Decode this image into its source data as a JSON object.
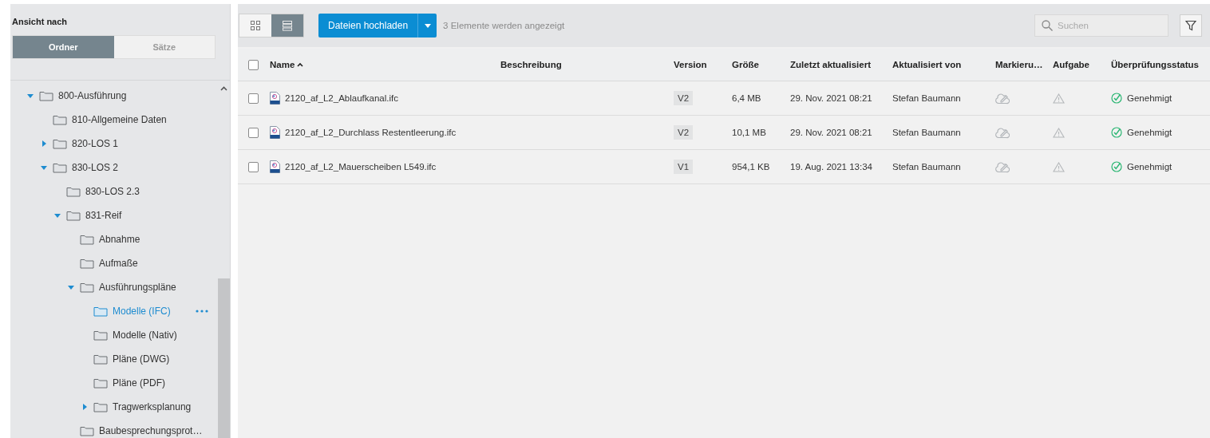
{
  "sidebar": {
    "title": "Ansicht nach",
    "view_tabs": [
      {
        "label": "Ordner",
        "selected": true
      },
      {
        "label": "Sätze",
        "selected": false
      }
    ],
    "tree": [
      {
        "label": "800-Ausführung",
        "expanded": true,
        "selected": false,
        "children": [
          {
            "label": "810-Allgemeine Daten",
            "selected": false
          },
          {
            "label": "820-LOS 1",
            "expanded": false,
            "selected": false
          },
          {
            "label": "830-LOS 2",
            "expanded": true,
            "selected": false,
            "children": [
              {
                "label": "830-LOS 2.3",
                "selected": false
              },
              {
                "label": "831-Reif",
                "expanded": true,
                "selected": false,
                "children": [
                  {
                    "label": "Abnahme",
                    "selected": false
                  },
                  {
                    "label": "Aufmaße",
                    "selected": false
                  },
                  {
                    "label": "Ausführungspläne",
                    "expanded": true,
                    "selected": false,
                    "children": [
                      {
                        "label": "Modelle (IFC)",
                        "selected": true
                      },
                      {
                        "label": "Modelle (Nativ)",
                        "selected": false
                      },
                      {
                        "label": "Pläne (DWG)",
                        "selected": false
                      },
                      {
                        "label": "Pläne (PDF)",
                        "selected": false
                      },
                      {
                        "label": "Tragwerksplanung",
                        "expanded": false,
                        "selected": false
                      }
                    ]
                  },
                  {
                    "label": "Baubesprechungsprot…",
                    "selected": false
                  }
                ]
              }
            ]
          }
        ]
      }
    ]
  },
  "toolbar": {
    "view_modes": [
      {
        "kind": "grid",
        "selected": false
      },
      {
        "kind": "list",
        "selected": true
      }
    ],
    "upload_button": "Dateien hochladen",
    "item_count": "3 Elemente werden angezeigt",
    "search": {
      "placeholder": "Suchen"
    }
  },
  "table": {
    "columns": [
      {
        "label": "Name",
        "sorted": true
      },
      {
        "label": "Beschreibung",
        "sorted": false
      },
      {
        "label": "Version",
        "sorted": false
      },
      {
        "label": "Größe",
        "sorted": false
      },
      {
        "label": "Zuletzt aktualisiert",
        "sorted": false
      },
      {
        "label": "Aktualisiert von",
        "sorted": false
      },
      {
        "label": "Markieru…",
        "sorted": false
      },
      {
        "label": "Aufgabe",
        "sorted": false
      },
      {
        "label": "Überprüfungsstatus",
        "sorted": false
      }
    ],
    "all_checked": false,
    "rows": [
      {
        "checked": false,
        "name": "2120_af_L2_Ablaufkanal.ifc",
        "version": "V2",
        "size": "6,4 MB",
        "updated": "29. Nov. 2021 08:21",
        "updated_by": "Stefan Baumann",
        "status": "Genehmigt"
      },
      {
        "checked": false,
        "name": "2120_af_L2_Durchlass Restentleerung.ifc",
        "version": "V2",
        "size": "10,1 MB",
        "updated": "29. Nov. 2021 08:21",
        "updated_by": "Stefan Baumann",
        "status": "Genehmigt"
      },
      {
        "checked": false,
        "name": "2120_af_L2_Mauerscheiben L549.ifc",
        "version": "V1",
        "size": "954,1 KB",
        "updated": "19. Aug. 2021 13:34",
        "updated_by": "Stefan Baumann",
        "status": "Genehmigt"
      }
    ]
  }
}
